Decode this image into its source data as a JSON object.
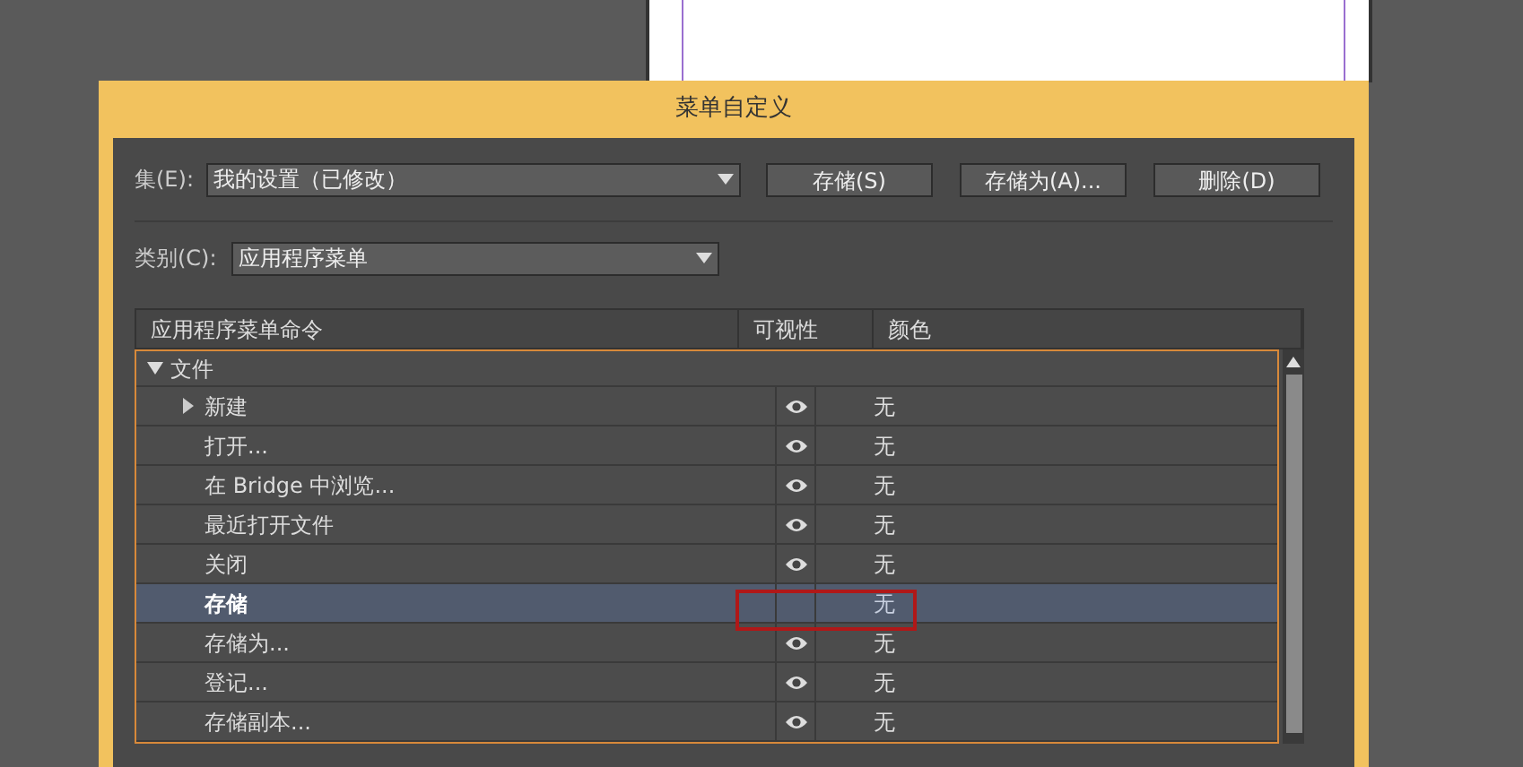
{
  "window": {
    "title": "菜单自定义"
  },
  "set": {
    "label": "集(E):",
    "value": "我的设置（已修改）"
  },
  "buttons": [
    "存储(S)",
    "存储为(A)...",
    "删除(D)"
  ],
  "category": {
    "label": "类别(C):",
    "value": "应用程序菜单"
  },
  "table": {
    "columns": [
      "应用程序菜单命令",
      "可视性",
      "颜色"
    ],
    "rows": [
      {
        "name": "文件",
        "expanded": true,
        "selected": false,
        "children": [
          {
            "name": "新建",
            "expanded": false,
            "visible": true,
            "color_value": "无",
            "selected": false
          },
          {
            "name": "打开...",
            "visible": true,
            "color_value": "无",
            "selected": false
          },
          {
            "name": "在 Bridge 中浏览...",
            "visible": true,
            "color_value": "无",
            "selected": false
          },
          {
            "name": "最近打开文件",
            "visible": true,
            "color_value": "无",
            "selected": false
          },
          {
            "name": "关闭",
            "visible": true,
            "color_value": "无",
            "selected": false
          },
          {
            "name": "存储",
            "visible": false,
            "color_value": "无",
            "selected": true
          },
          {
            "name": "存储为...",
            "visible": true,
            "color_value": "无",
            "selected": false
          },
          {
            "name": "登记...",
            "visible": true,
            "color_value": "无",
            "selected": false
          },
          {
            "name": "存储副本...",
            "visible": true,
            "color_value": "无",
            "selected": false
          }
        ]
      }
    ]
  }
}
